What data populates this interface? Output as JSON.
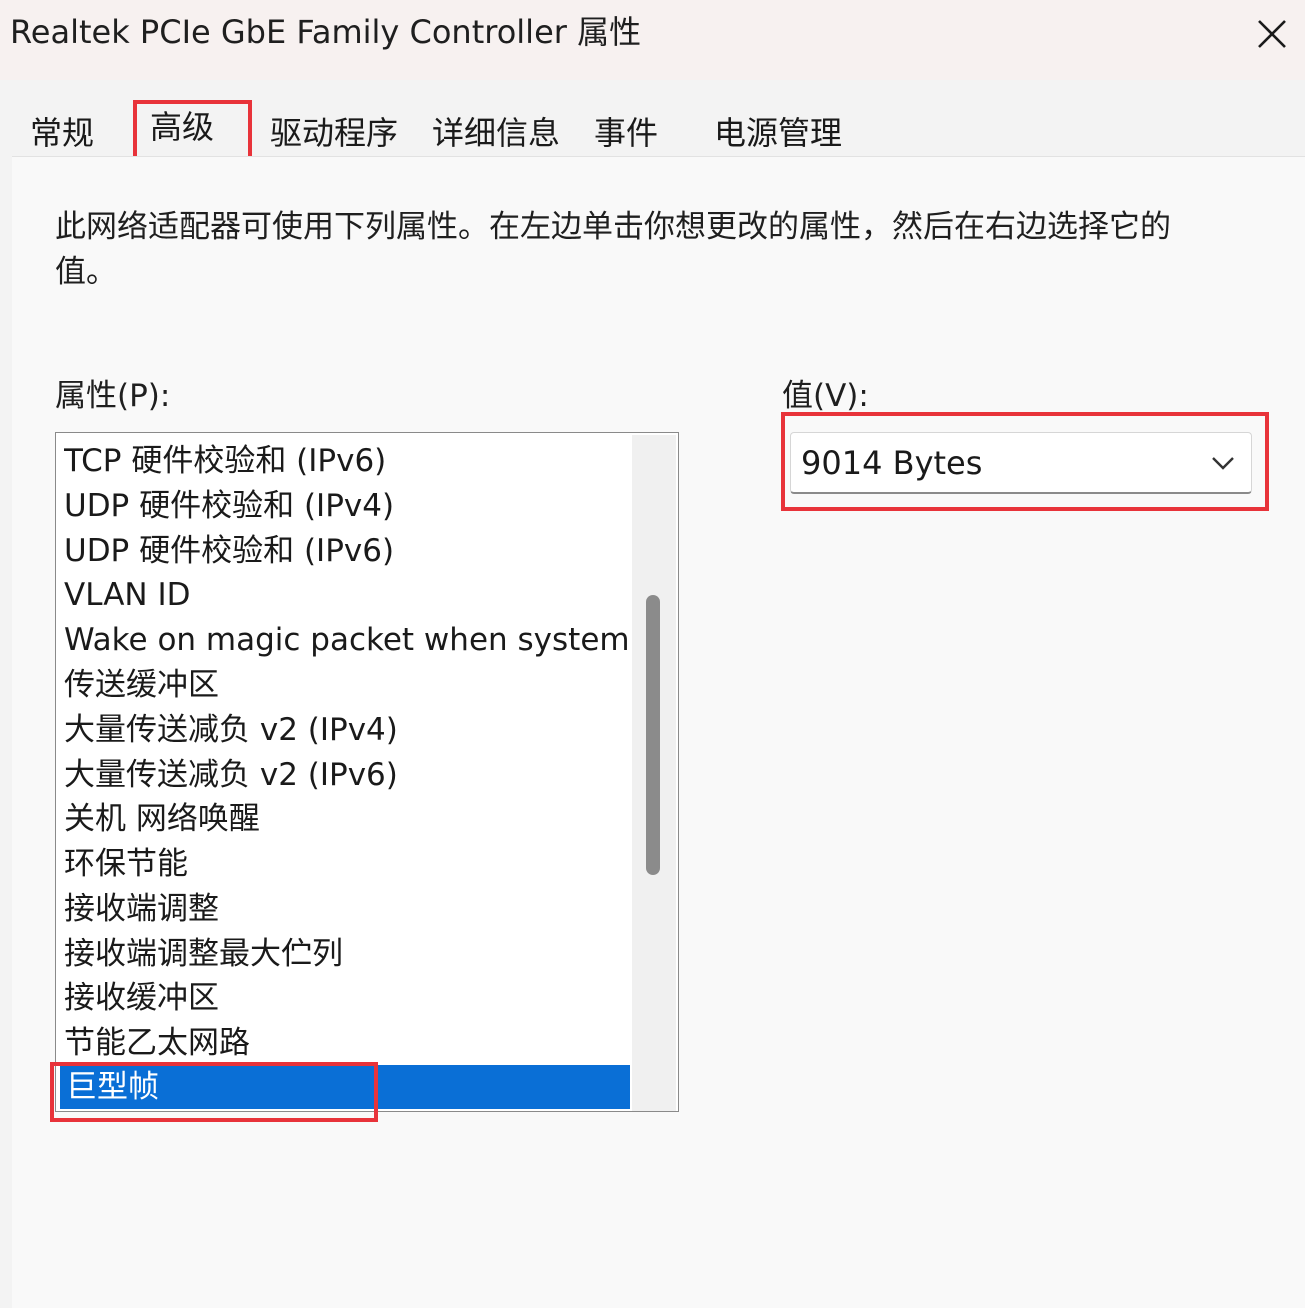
{
  "window": {
    "title": "Realtek PCIe GbE Family Controller 属性",
    "close_icon": "close-icon"
  },
  "tabs": [
    {
      "label": "常规"
    },
    {
      "label": "高级"
    },
    {
      "label": "驱动程序"
    },
    {
      "label": "详细信息"
    },
    {
      "label": "事件"
    },
    {
      "label": "电源管理"
    }
  ],
  "description": "此网络适配器可使用下列属性。在左边单击你想更改的属性，然后在右边选择它的值。",
  "property_label": "属性(P):",
  "value_label": "值(V):",
  "properties": [
    "TCP 硬件校验和 (IPv6)",
    "UDP 硬件校验和 (IPv4)",
    "UDP 硬件校验和 (IPv6)",
    "VLAN ID",
    "Wake on magic packet when system",
    "传送缓冲区",
    "大量传送减负 v2 (IPv4)",
    "大量传送减负 v2 (IPv6)",
    "关机 网络唤醒",
    "环保节能",
    "接收端调整",
    "接收端调整最大伫列",
    "接收缓冲区",
    "节能乙太网路",
    "巨型帧"
  ],
  "selected_property": "巨型帧",
  "value": {
    "selected": "9014 Bytes",
    "icon": "chevron-down-icon"
  },
  "colors": {
    "highlight_box": "#e8333a",
    "selection": "#0a6fd6"
  }
}
